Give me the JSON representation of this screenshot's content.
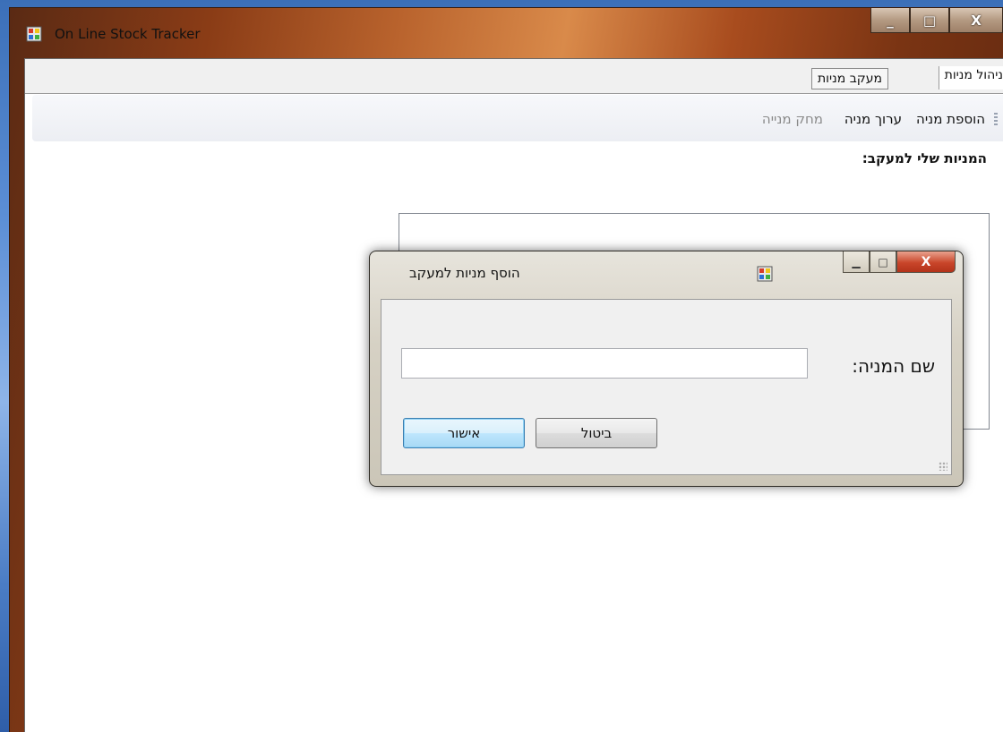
{
  "main_window": {
    "title": "On Line Stock Tracker",
    "icon": "app-icon",
    "controls": {
      "minimize": "_",
      "maximize": "□",
      "close": "X"
    }
  },
  "tabs": [
    {
      "label": "ניהול מניות",
      "active": true
    },
    {
      "label": "מעקב מניות",
      "active": false
    }
  ],
  "toolbar": {
    "add_label": "הוספת מניה",
    "edit_label": "ערוך מניה",
    "delete_label": "מחק מנייה"
  },
  "main": {
    "section_label": "המניות שלי למעקב:"
  },
  "dialog": {
    "title": "הוסף מניות למעקב",
    "icon": "app-icon",
    "controls": {
      "minimize": "▁",
      "maximize": "□",
      "close": "X"
    },
    "name_label": "שם המניה:",
    "name_value": "",
    "name_placeholder": "",
    "ok_label": "אישור",
    "cancel_label": "ביטול"
  },
  "colors": {
    "accent_ok_border": "#3c7fb1",
    "dialog_close": "#c9462a"
  }
}
